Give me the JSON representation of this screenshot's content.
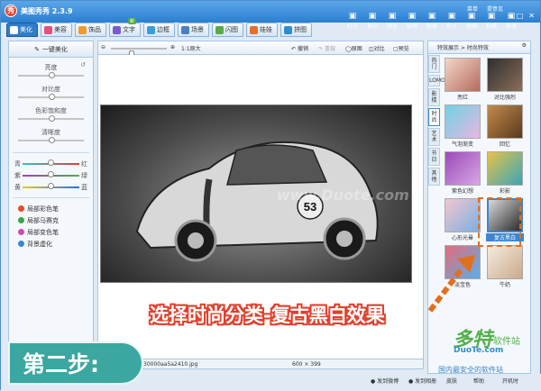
{
  "app": {
    "title": "美图秀秀 2.3.9",
    "logo_glyph": "秀",
    "top_links": [
      "菜单",
      "提意见"
    ]
  },
  "toolbar_right": [
    {
      "label": "打开",
      "icon": "folder-icon"
    },
    {
      "label": "保存",
      "icon": "save-icon"
    },
    {
      "label": "预览",
      "icon": "preview-icon"
    },
    {
      "label": "旋转",
      "icon": "rotate-icon"
    },
    {
      "label": "剪裁",
      "icon": "crop-icon"
    },
    {
      "label": "尺寸",
      "icon": "resize-icon"
    },
    {
      "label": "涂鸦",
      "icon": "brush-icon"
    },
    {
      "label": "拍照",
      "icon": "camera-icon"
    },
    {
      "label": "微博",
      "icon": "weibo-icon"
    }
  ],
  "tabs": [
    {
      "label": "美化",
      "color": "#2f7cc7",
      "active": true
    },
    {
      "label": "美容",
      "color": "#e3507a",
      "active": false
    },
    {
      "label": "饰品",
      "color": "#f09a2c",
      "active": false
    },
    {
      "label": "文字",
      "color": "#7a5bd1",
      "active": false
    },
    {
      "label": "边框",
      "color": "#3b9ed6",
      "active": false
    },
    {
      "label": "场景",
      "color": "#4b7fc2",
      "active": false
    },
    {
      "label": "闪图",
      "color": "#5aa84a",
      "active": false
    },
    {
      "label": "娃娃",
      "color": "#e0702a",
      "active": false
    },
    {
      "label": "拼图",
      "color": "#2b8ed0",
      "active": false
    }
  ],
  "new_badge": "新",
  "left_panel": {
    "header": "一键美化",
    "sliders": [
      {
        "label": "亮度",
        "value": 0.5
      },
      {
        "label": "对比度",
        "value": 0.5
      },
      {
        "label": "色彩饱和度",
        "value": 0.5
      },
      {
        "label": "清晰度",
        "value": 0.5
      }
    ],
    "color_balance": [
      {
        "left": "青",
        "right": "红",
        "gradient": "linear-gradient(90deg,#2ec6c6,#e23a3a)"
      },
      {
        "left": "紫",
        "right": "绿",
        "gradient": "linear-gradient(90deg,#b03ab8,#3ab84a)"
      },
      {
        "left": "黄",
        "right": "蓝",
        "gradient": "linear-gradient(90deg,#e6c82a,#2a6ae6)"
      }
    ],
    "local_tools": [
      {
        "label": "局部彩色笔",
        "color": "#e84a2a"
      },
      {
        "label": "局部马赛克",
        "color": "#3ba54a"
      },
      {
        "label": "局部变色笔",
        "color": "#d04ab0"
      },
      {
        "label": "背景虚化",
        "color": "#3b86cf"
      }
    ]
  },
  "canvas_bar": {
    "zoom_label": "1:1原大",
    "undo": "撤销",
    "redo": "重做",
    "original": "原图",
    "compare": "对比",
    "preview": "预览"
  },
  "photo": {
    "car_number": "53",
    "watermark": "www.Duote.com"
  },
  "status": {
    "filename": "30000aa5a2410.jpg",
    "dimensions": "600 × 399"
  },
  "right_panel": {
    "header": "特效展示 > 时尚特效",
    "vertical_tabs": [
      "热门",
      "LOMO",
      "影楼",
      "时尚",
      "艺术",
      "节日",
      "其他"
    ],
    "active_vtab": "时尚",
    "effects": [
      {
        "label": "亮红",
        "gradient": "linear-gradient(135deg,#f3d6c9,#b56b5e)"
      },
      {
        "label": "对比强烈",
        "gradient": "linear-gradient(135deg,#2f2f2f,#8a6e5a)"
      },
      {
        "label": "气泡渐变",
        "gradient": "linear-gradient(135deg,#6fd2e6,#e6b7e0)"
      },
      {
        "label": "回忆",
        "gradient": "linear-gradient(135deg,#c38a4c,#5a3a1e)"
      },
      {
        "label": "紫色幻想",
        "gradient": "linear-gradient(135deg,#9a4ab8,#d9a6e6)"
      },
      {
        "label": "彩影",
        "gradient": "linear-gradient(135deg,#e6c24a,#3aa6b8)"
      },
      {
        "label": "心形光晕",
        "gradient": "linear-gradient(135deg,#f3c6d0,#7ab0e0)"
      },
      {
        "label": "复古黑白",
        "gradient": "linear-gradient(135deg,#d9d9d9,#2a2a2a)"
      },
      {
        "label": "淡宝色",
        "gradient": "linear-gradient(135deg,#e66a7a,#5ab0e6)"
      },
      {
        "label": "牛奶",
        "gradient": "linear-gradient(135deg,#f6ece0,#c9a98a)"
      }
    ],
    "selected_effect": "复古黑白"
  },
  "overlay": {
    "instruction": "选择时尚分类-复古黑白效果",
    "step_label": "第二步:",
    "accent_color": "#e2402d",
    "step_color": "#3ba7a0"
  },
  "bottom_bar": {
    "items": [
      "发到微博",
      "发到相册",
      "皮肤",
      "帮助",
      "开机时"
    ]
  },
  "watermarks": {
    "brand_cn": "多特",
    "brand_sub": "软件站",
    "brand_url": "DuoTe.com",
    "slogan": "国内最安全的软件站"
  }
}
